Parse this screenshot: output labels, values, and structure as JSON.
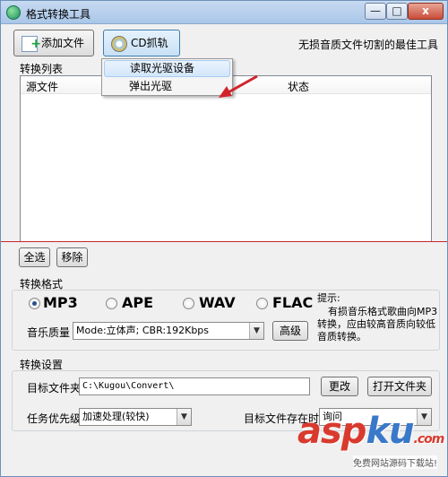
{
  "window": {
    "title": "格式转换工具",
    "min_label": "—",
    "max_label": "□",
    "close_label": "x"
  },
  "toolbar": {
    "add_file_label": "添加文件",
    "cd_rip_label": "CD抓轨",
    "tagline": "无损音质文件切割的最佳工具"
  },
  "cd_menu": {
    "items": [
      "读取光驱设备",
      "弹出光驱"
    ]
  },
  "file_list": {
    "label": "转换列表",
    "columns": [
      "源文件",
      "状态"
    ]
  },
  "list_actions": {
    "select_all_label": "全选",
    "remove_label": "移除"
  },
  "format_group": {
    "title": "转换格式",
    "options": [
      {
        "label": "MP3",
        "selected": true
      },
      {
        "label": "APE",
        "selected": false
      },
      {
        "label": "WAV",
        "selected": false
      },
      {
        "label": "FLAC",
        "selected": false
      }
    ],
    "quality_label": "音乐质量",
    "quality_value": "Mode:立体声; CBR:192Kbps",
    "advanced_label": "高级",
    "hint_title": "提示:",
    "hint_body": "有损音乐格式歌曲向MP3转换，应由较高音质向较低音质转换。"
  },
  "settings_group": {
    "title": "转换设置",
    "target_folder_label": "目标文件夹",
    "target_folder_value": "C:\\Kugou\\Convert\\",
    "change_label": "更改",
    "open_folder_label": "打开文件夹",
    "priority_label": "任务优先级",
    "priority_value": "加速处理(较快)",
    "exists_label": "目标文件存在时",
    "exists_value": "询问"
  },
  "watermark": {
    "brand_a": "asp",
    "brand_b": "ku",
    "brand_c": ".com",
    "sub": "免费网站源码下载站!"
  }
}
